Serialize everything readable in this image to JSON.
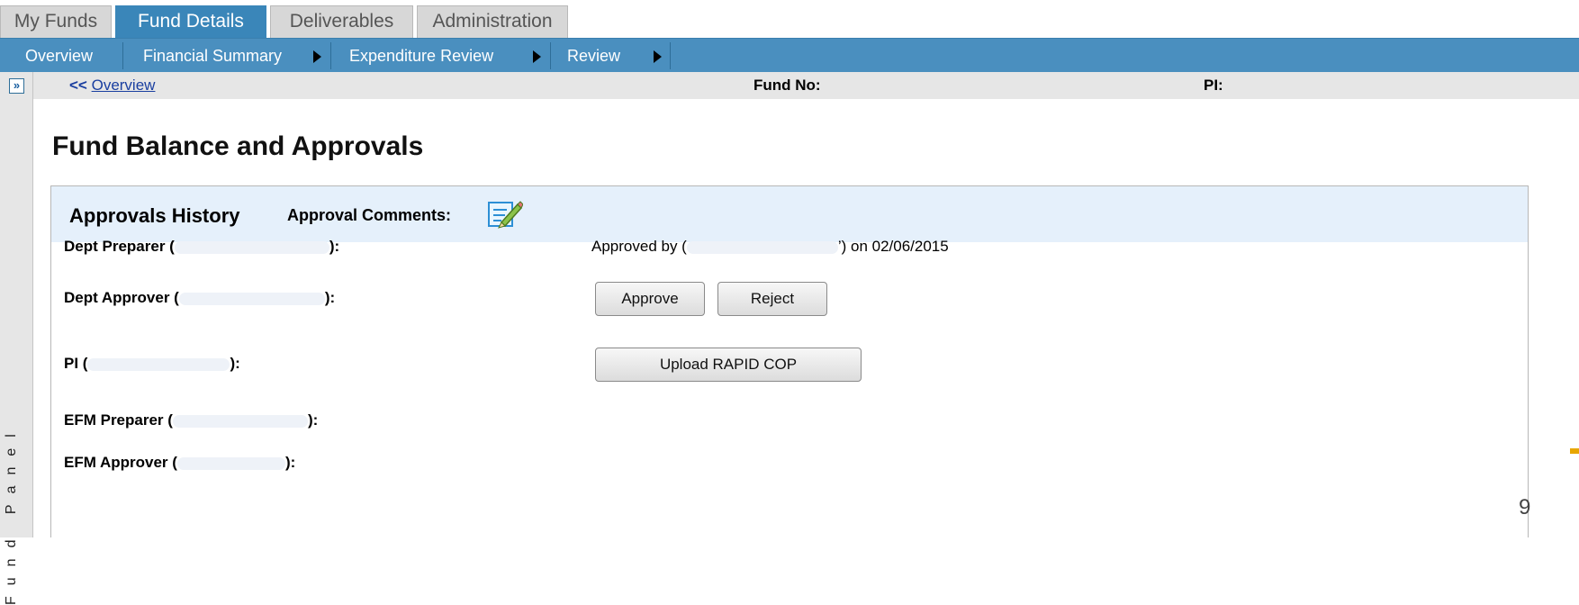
{
  "tabs": [
    "My Funds",
    "Fund Details",
    "Deliverables",
    "Administration"
  ],
  "nav": {
    "items": [
      "Overview",
      "Financial Summary",
      "Expenditure Review",
      "Review"
    ]
  },
  "left_panel": {
    "expand_glyph": "»",
    "label": "Fund Panel"
  },
  "infobar": {
    "back_prefix": "<<",
    "back_link": "Overview",
    "fund_no_label": "Fund No:",
    "pi_label": "PI:"
  },
  "page_title": "Fund Balance and Approvals",
  "approvals": {
    "title": "Approvals History",
    "comments_label": "Approval Comments:",
    "rows": [
      {
        "label_prefix": "Dept Preparer (",
        "label_suffix": "):",
        "status_prefix": "Approved by (",
        "status_suffix": "’) on 02/06/2015"
      },
      {
        "label_prefix": "Dept Approver (",
        "label_suffix": "):"
      },
      {
        "label_prefix": "PI (",
        "label_suffix": "):"
      },
      {
        "label_prefix": "EFM Preparer (",
        "label_suffix": "):"
      },
      {
        "label_prefix": "EFM Approver (",
        "label_suffix": "):"
      }
    ],
    "buttons": {
      "approve": "Approve",
      "reject": "Reject",
      "upload": "Upload RAPID COP"
    }
  },
  "slide_number": "9",
  "colors": {
    "accent": "#4a8fbf",
    "active_tab": "#3a86b9",
    "panel_header": "#e5f0fb"
  },
  "icons": {
    "expand": "double-chevron-right-icon",
    "comments": "edit-pencil-icon"
  }
}
